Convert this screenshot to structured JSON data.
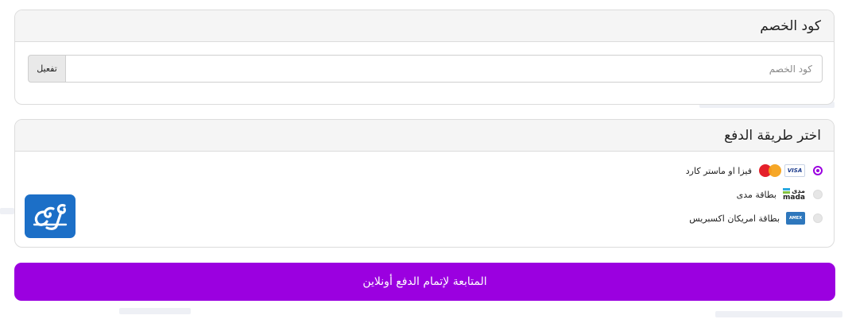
{
  "coupon": {
    "title": "كود الخصم",
    "input_placeholder": "كود الخصم",
    "input_value": "",
    "activate_label": "تفعيل"
  },
  "payment": {
    "title": "اختر طريقة الدفع",
    "options": [
      {
        "label": "فيزا او ماستر كارد",
        "selected": true,
        "logos": [
          "visa-icon",
          "mastercard-icon"
        ]
      },
      {
        "label": "بطاقة مدى",
        "selected": false,
        "logos": [
          "mada-icon"
        ]
      },
      {
        "label": "بطاقة امريكان اكسبريس",
        "selected": false,
        "logos": [
          "amex-icon"
        ]
      }
    ],
    "visa_logo_text": "VISA",
    "mada_logo_ar": "مدى",
    "mada_logo_en": "mada"
  },
  "proceed_label": "المتابعة لإتمام الدفع أونلاين",
  "colors": {
    "accent": "#9b00e0",
    "brand_logo": "#1c6fc7"
  }
}
